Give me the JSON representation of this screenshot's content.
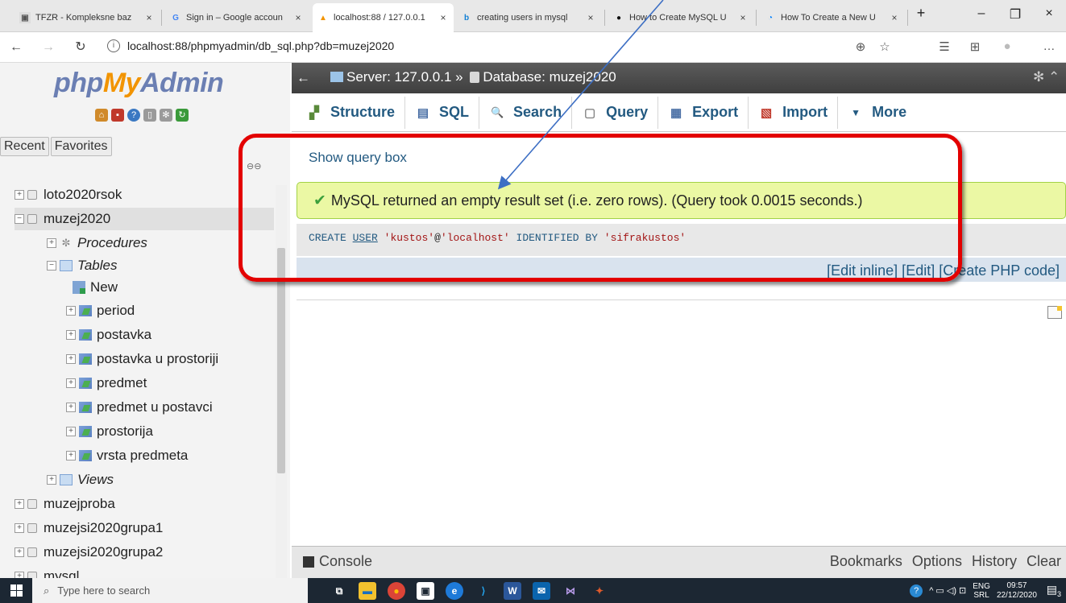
{
  "browser": {
    "tabs": [
      {
        "label": "TFZR - Kompleksne baz",
        "icon": "tfzr-favicon",
        "active": false
      },
      {
        "label": "Sign in – Google accoun",
        "icon": "google-favicon",
        "active": false
      },
      {
        "label": "localhost:88 / 127.0.0.1",
        "icon": "phpmyadmin-favicon",
        "active": true
      },
      {
        "label": "creating users in mysql",
        "icon": "bing-favicon",
        "active": false
      },
      {
        "label": "How to Create MySQL U",
        "icon": "github-favicon",
        "active": false
      },
      {
        "label": "How To Create a New U",
        "icon": "digitalocean-favicon",
        "active": false
      }
    ],
    "close_glyph": "×",
    "new_tab_glyph": "+",
    "window_controls": [
      "–",
      "❐",
      "×"
    ],
    "nav": {
      "back": "←",
      "forward": "→",
      "refresh": "↻",
      "info": "i"
    },
    "url": "localhost:88/phpmyadmin/db_sql.php?db=muzej2020",
    "right_icons": [
      "⊕",
      "☆",
      "☰",
      "⊞",
      "●",
      "…"
    ]
  },
  "pma": {
    "logo": {
      "php": "php",
      "my": "My",
      "admin": "Admin"
    },
    "logo_icons": [
      {
        "name": "home-icon",
        "glyph": "⌂",
        "color": "#d08a2a"
      },
      {
        "name": "exit-icon",
        "glyph": "▪",
        "color": "#c0392b"
      },
      {
        "name": "help-icon",
        "glyph": "?",
        "color": "#3a78c2"
      },
      {
        "name": "docs-icon",
        "glyph": "▯",
        "color": "#9a9a9a"
      },
      {
        "name": "settings-icon",
        "glyph": "✻",
        "color": "#9a9a9a"
      },
      {
        "name": "reload-icon",
        "glyph": "↻",
        "color": "#3a9a3a"
      }
    ],
    "nav_tabs": [
      "Recent",
      "Favorites"
    ],
    "tree": {
      "loto": "loto2020rsok",
      "muzej": "muzej2020",
      "procedures": "Procedures",
      "tables": "Tables",
      "new": "New",
      "table_items": [
        "period",
        "postavka",
        "postavka u prostoriji",
        "predmet",
        "predmet u postavci",
        "prostorija",
        "vrsta predmeta"
      ],
      "views": "Views",
      "more_dbs": [
        "muzejproba",
        "muzejsi2020grupa1",
        "muzejsi2020grupa2",
        "mysql"
      ]
    },
    "server_bar": {
      "back": "←",
      "server": "Server: 127.0.0.1",
      "sep": "»",
      "database": "Database: muzej2020"
    },
    "tabs": [
      {
        "label": "Structure",
        "icon": "structure-icon",
        "glyph": "▞"
      },
      {
        "label": "SQL",
        "icon": "sql-icon",
        "glyph": "▤"
      },
      {
        "label": "Search",
        "icon": "search-icon",
        "glyph": "🔍"
      },
      {
        "label": "Query",
        "icon": "query-icon",
        "glyph": "▢"
      },
      {
        "label": "Export",
        "icon": "export-icon",
        "glyph": "▦"
      },
      {
        "label": "Import",
        "icon": "import-icon",
        "glyph": "▧"
      },
      {
        "label": "More",
        "icon": "more-caret-icon",
        "glyph": "▼"
      }
    ],
    "show_query_box": "Show query box",
    "success_message": "MySQL returned an empty result set (i.e. zero rows). (Query took 0.0015 seconds.)",
    "sql": {
      "kw1": "CREATE",
      "kw2": "USER",
      "user": "'kustos'",
      "at": "@",
      "host": "'localhost'",
      "kw3": "IDENTIFIED BY",
      "pwd": "'sifrakustos'"
    },
    "edit_links": {
      "edit_inline": "Edit inline",
      "edit": "Edit",
      "create_php": "Create PHP code"
    },
    "console": {
      "label": "Console",
      "links": [
        "Bookmarks",
        "Options",
        "History",
        "Clear"
      ]
    }
  },
  "taskbar": {
    "search_placeholder": "Type here to search",
    "apps": [
      {
        "name": "task-view-icon",
        "glyph": "⧉",
        "color": "transparent"
      },
      {
        "name": "file-explorer-icon",
        "glyph": "▬",
        "color": "#f2c12e"
      },
      {
        "name": "chrome-icon",
        "glyph": "●",
        "color": "#db4437"
      },
      {
        "name": "store-icon",
        "glyph": "▣",
        "color": "#ffffff"
      },
      {
        "name": "edge-icon",
        "glyph": "e",
        "color": "#1e7ad8"
      },
      {
        "name": "vscode-icon",
        "glyph": "⟩",
        "color": "#23a7f2"
      },
      {
        "name": "word-icon",
        "glyph": "W",
        "color": "#2b579a"
      },
      {
        "name": "mail-icon",
        "glyph": "✉",
        "color": "#0a64ad"
      },
      {
        "name": "visual-studio-icon",
        "glyph": "⋈",
        "color": "#8661c5"
      },
      {
        "name": "app-icon",
        "glyph": "✦",
        "color": "#e05a2b"
      }
    ],
    "tray_glyphs": "^  ▭  ◁)  ⊡",
    "lang": "ENG",
    "lang_sub": "SRL",
    "time": "09:57",
    "date": "22/12/2020",
    "notification_count": "3"
  }
}
